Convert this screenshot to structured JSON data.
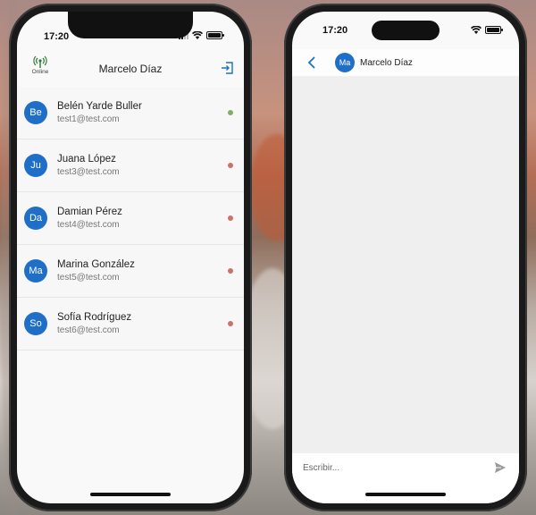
{
  "status": {
    "time": "17:20"
  },
  "left_screen": {
    "header": {
      "title": "Marcelo Díaz",
      "online_label": "Online",
      "logout_icon": "logout-icon"
    },
    "users": [
      {
        "initials": "Be",
        "name": "Belén Yarde Buller",
        "email": "test1@test.com",
        "status": "online",
        "status_color": "#7fae6b"
      },
      {
        "initials": "Ju",
        "name": "Juana López",
        "email": "test3@test.com",
        "status": "offline",
        "status_color": "#c9736b"
      },
      {
        "initials": "Da",
        "name": "Damian Pérez",
        "email": "test4@test.com",
        "status": "offline",
        "status_color": "#c9736b"
      },
      {
        "initials": "Ma",
        "name": "Marina González",
        "email": "test5@test.com",
        "status": "offline",
        "status_color": "#c9736b"
      },
      {
        "initials": "So",
        "name": "Sofía Rodríguez",
        "email": "test6@test.com",
        "status": "offline",
        "status_color": "#c9736b"
      }
    ]
  },
  "right_screen": {
    "header": {
      "avatar_initials": "Ma",
      "name": "Marcelo Díaz",
      "back_icon": "back-chevron-icon"
    },
    "input": {
      "placeholder": "Escribir...",
      "value": ""
    },
    "send_icon": "send-icon"
  },
  "colors": {
    "accent": "#1f6fc9",
    "online": "#7fae6b",
    "offline": "#c9736b"
  }
}
